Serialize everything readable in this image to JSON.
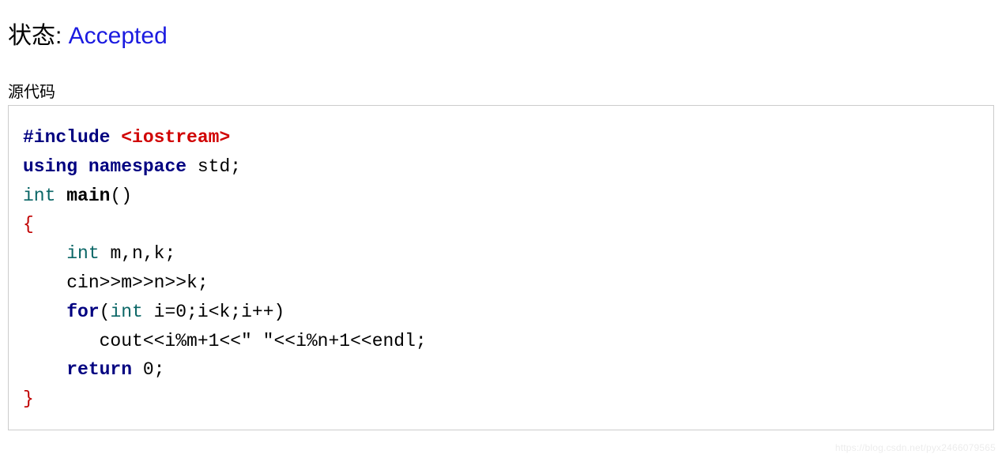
{
  "status": {
    "label": "状态: ",
    "value": "Accepted"
  },
  "source_label": "源代码",
  "code": {
    "tokens": [
      {
        "t": "#include ",
        "c": "kw-pre"
      },
      {
        "t": "<iostream>",
        "c": "hdr"
      },
      {
        "t": "\n"
      },
      {
        "t": "using",
        "c": "kw-pre"
      },
      {
        "t": " "
      },
      {
        "t": "namespace",
        "c": "kw-pre"
      },
      {
        "t": " std;\n"
      },
      {
        "t": "int",
        "c": "typ"
      },
      {
        "t": " "
      },
      {
        "t": "main",
        "c": "fn"
      },
      {
        "t": "()\n"
      },
      {
        "t": "{",
        "c": "brace"
      },
      {
        "t": "\n"
      },
      {
        "t": "    "
      },
      {
        "t": "int",
        "c": "typ"
      },
      {
        "t": " m,n,k;\n"
      },
      {
        "t": "    cin>>m>>n>>k;\n"
      },
      {
        "t": "    "
      },
      {
        "t": "for",
        "c": "kw-pre"
      },
      {
        "t": "("
      },
      {
        "t": "int",
        "c": "typ"
      },
      {
        "t": " i=0;i<k;i++)\n"
      },
      {
        "t": "       cout<<i%m+1<<"
      },
      {
        "t": "\" \"",
        "c": "str"
      },
      {
        "t": "<<i%n+1<<endl;\n"
      },
      {
        "t": "    "
      },
      {
        "t": "return",
        "c": "kw-pre"
      },
      {
        "t": " 0;\n"
      },
      {
        "t": "}",
        "c": "brace"
      }
    ]
  },
  "watermark": "https://blog.csdn.net/pyx2466079565"
}
